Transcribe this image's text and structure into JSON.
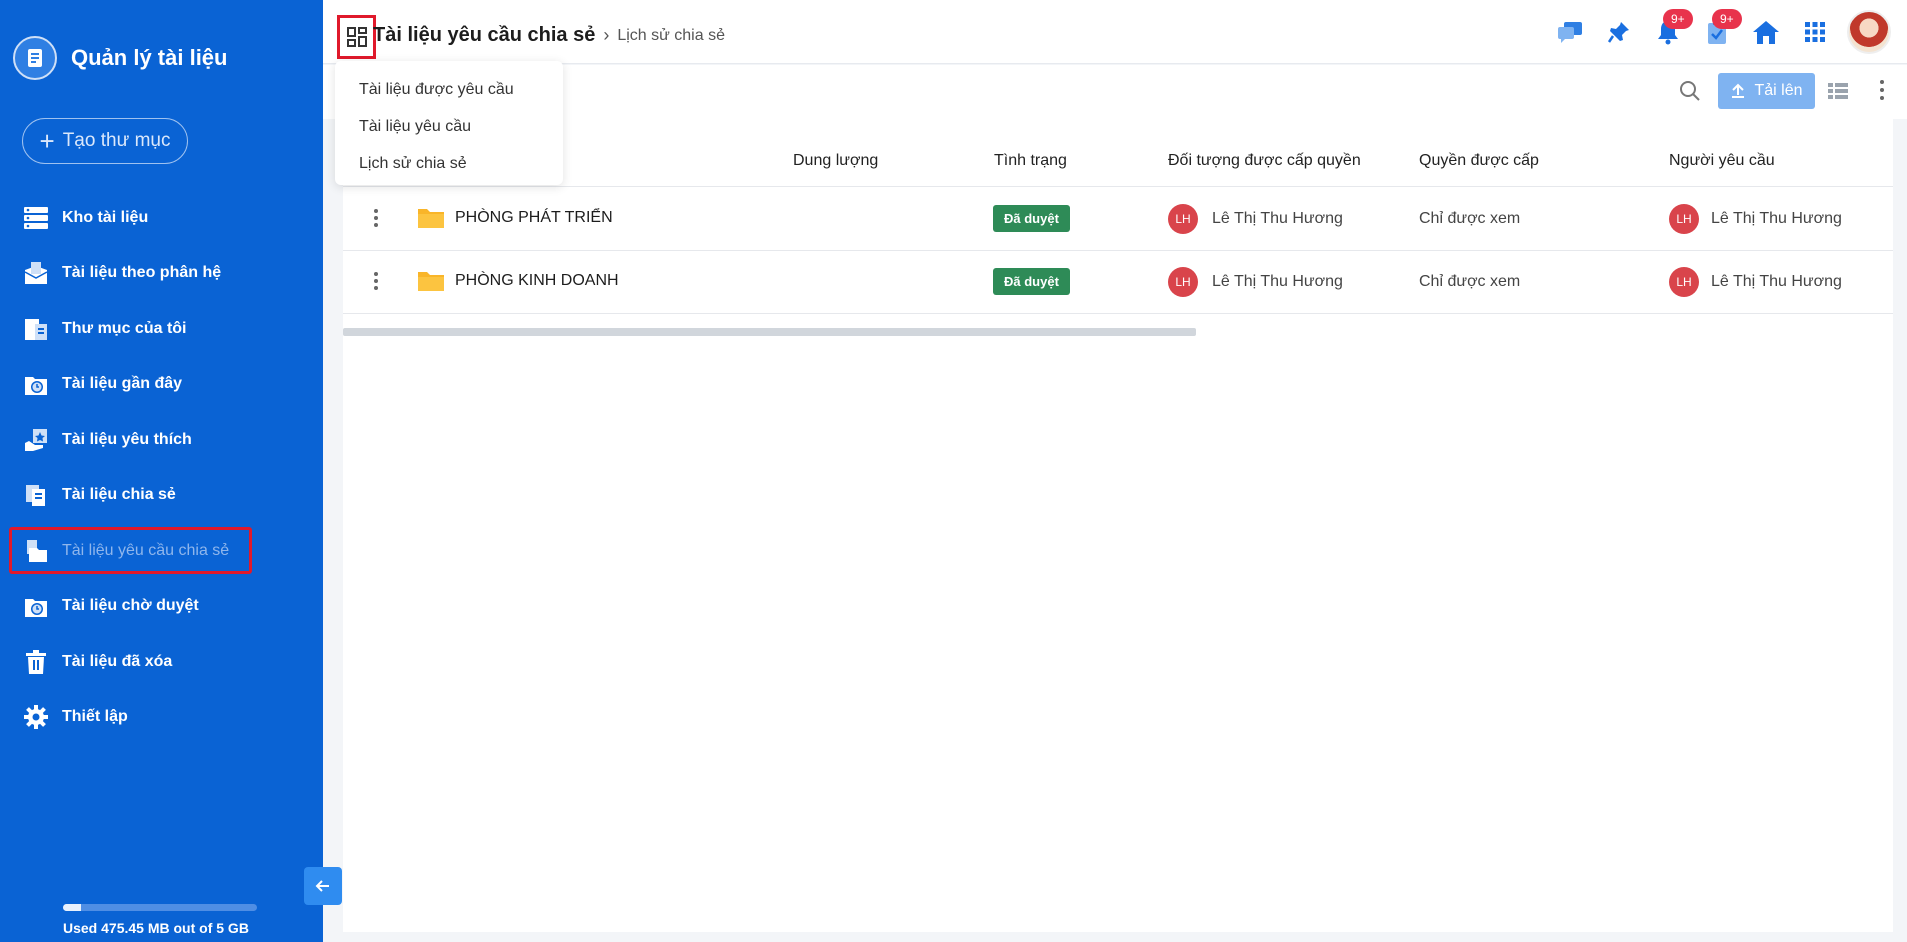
{
  "sidebar": {
    "app_title": "Quản lý tài liệu",
    "new_folder_label": "Tạo thư mục",
    "items": [
      {
        "label": "Kho tài liệu",
        "icon": "server-icon"
      },
      {
        "label": "Tài liệu theo phân hệ",
        "icon": "module-docs-icon"
      },
      {
        "label": "Thư mục của tôi",
        "icon": "my-folder-icon"
      },
      {
        "label": "Tài liệu gần đây",
        "icon": "recent-docs-icon"
      },
      {
        "label": "Tài liệu yêu thích",
        "icon": "favorite-docs-icon"
      },
      {
        "label": "Tài liệu chia sẻ",
        "icon": "shared-docs-icon"
      },
      {
        "label": "Tài liệu yêu cầu chia sẻ",
        "icon": "share-request-icon",
        "active": true
      },
      {
        "label": "Tài liệu chờ duyệt",
        "icon": "pending-docs-icon"
      },
      {
        "label": "Tài liệu đã xóa",
        "icon": "trash-icon"
      },
      {
        "label": "Thiết lập",
        "icon": "gear-icon"
      }
    ],
    "storage_text": "Used 475.45 MB out of 5 GB",
    "storage_used_fraction": 0.093
  },
  "header": {
    "breadcrumb_main": "Tài liệu yêu cầu chia sẻ",
    "breadcrumb_sub": "Lịch sử chia sẻ",
    "notification_badge": "9+",
    "task_badge": "9+"
  },
  "dropdown": {
    "items": [
      "Tài liệu được yêu cầu",
      "Tài liệu yêu cầu",
      "Lịch sử chia sẻ"
    ]
  },
  "toolbar": {
    "upload_label": "Tải lên"
  },
  "table": {
    "columns": {
      "size": "Dung lượng",
      "status": "Tình trạng",
      "grantee": "Đối tượng được cấp quyền",
      "permission": "Quyền được cấp",
      "requester": "Người yêu cầu"
    },
    "rows": [
      {
        "name": "PHÒNG PHÁT TRIỂN",
        "status": "Đã duyệt",
        "grantee_initials": "LH",
        "grantee": "Lê Thị Thu Hương",
        "permission": "Chỉ được xem",
        "requester_initials": "LH",
        "requester": "Lê Thị Thu Hương"
      },
      {
        "name": "PHÒNG KINH DOANH",
        "status": "Đã duyệt",
        "grantee_initials": "LH",
        "grantee": "Lê Thị Thu Hương",
        "permission": "Chỉ được xem",
        "requester_initials": "LH",
        "requester": "Lê Thị Thu Hương"
      }
    ]
  },
  "colors": {
    "sidebar_bg": "#0a63d4",
    "status_approved": "#2e8b57",
    "avatar_bg": "#d9444b",
    "highlight": "#e0192b"
  }
}
